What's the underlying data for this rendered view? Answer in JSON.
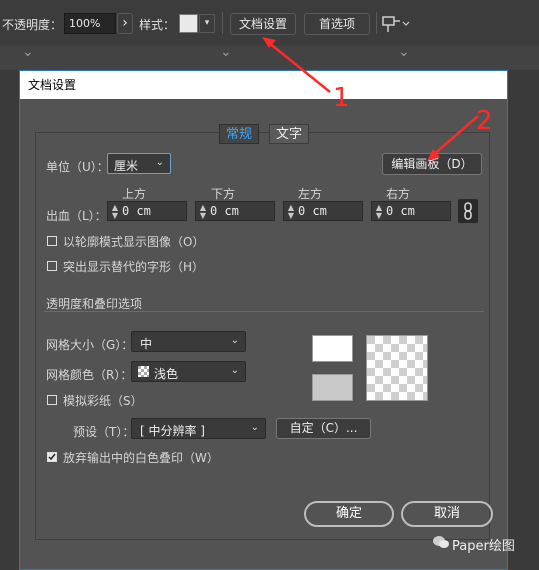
{
  "topbar": {
    "opacity_label": "不透明度：",
    "opacity_value": "100%",
    "opacity_arrow": "›",
    "style_label": "样式：",
    "doc_setup_button": "文档设置",
    "prefs_button": "首选项"
  },
  "dialog": {
    "title": "文档设置",
    "tabs": [
      "常规",
      "文字"
    ],
    "units_label": "单位（U）：",
    "units_value": "厘米",
    "edit_artboards_button": "编辑画板（D）",
    "bleed_label": "出血（L）：",
    "bleed_headers": [
      "上方",
      "下方",
      "左方",
      "右方"
    ],
    "bleed_values": [
      "0 cm",
      "0 cm",
      "0 cm",
      "0 cm"
    ],
    "outline_mode_label": "以轮廓模式显示图像（O）",
    "highlight_glyphs_label": "突出显示替代的字形（H）",
    "transparency_section": "透明度和叠印选项",
    "grid_size_label": "网格大小（G）：",
    "grid_size_value": "中",
    "grid_color_label": "网格颜色（R）：",
    "grid_color_value": "浅色",
    "simulate_paper_label": "模拟彩纸（S）",
    "preset_label": "预设（T）：",
    "preset_value": "[ 中分辨率 ]",
    "custom_button": "自定（C）...",
    "discard_white_label": "放弃输出中的白色叠印（W）",
    "ok_button": "确定",
    "cancel_button": "取消"
  },
  "annotations": [
    "1",
    "2"
  ],
  "watermark": "Paper绘图",
  "colors": {
    "accent": "#2b78c2",
    "annotation": "#ff2a2a",
    "tab_active_text": "#3da5ff"
  }
}
